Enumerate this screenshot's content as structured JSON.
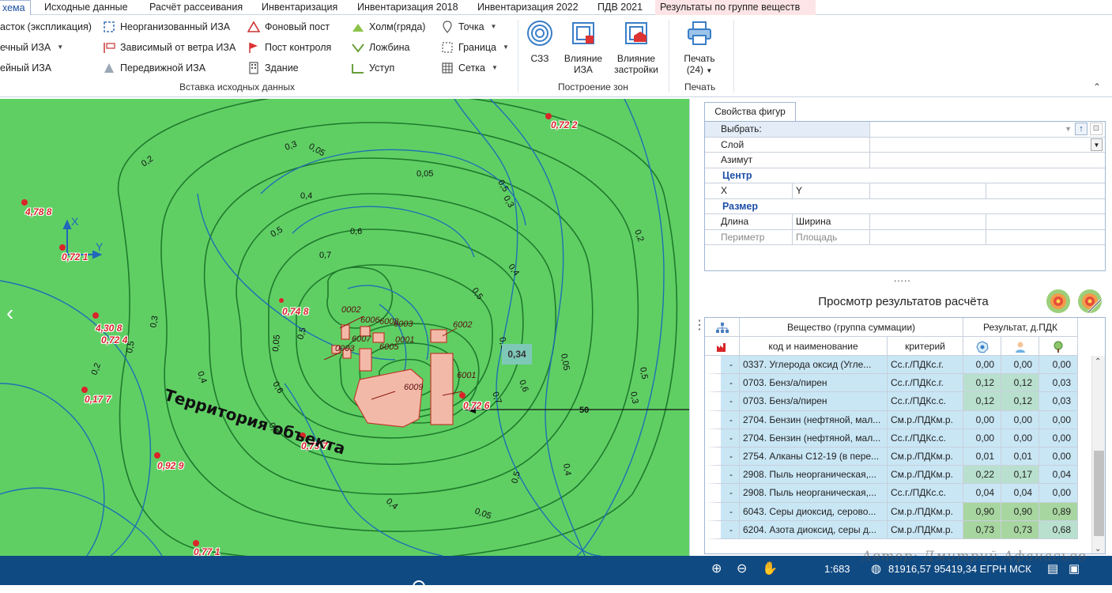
{
  "tabs": [
    "хема",
    "Исходные данные",
    "Расчёт рассеивания",
    "Инвентаризация",
    "Инвентаризация 2018",
    "Инвентаризация 2022",
    "ПДВ 2021",
    "Результаты по группе веществ"
  ],
  "ribbon": {
    "col1": [
      "асток (экспликация)",
      "ечный ИЗА",
      "ейный ИЗА"
    ],
    "col2": [
      "Неорганизованный ИЗА",
      "Зависимый от ветра ИЗА",
      "Передвижной ИЗА"
    ],
    "col3": [
      "Фоновый пост",
      "Пост контроля",
      "Здание"
    ],
    "col4": [
      "Холм(гряда)",
      "Ложбина",
      "Уступ"
    ],
    "col5": [
      "Точка",
      "Граница",
      "Сетка"
    ],
    "group_insert": "Вставка исходных данных",
    "szz": "СЗЗ",
    "iza_influence": [
      "Влияние",
      "ИЗА"
    ],
    "build_influence": [
      "Влияние",
      "застройки"
    ],
    "group_zones": "Построение зон",
    "print": [
      "Печать",
      "(24)"
    ],
    "group_print": "Печать"
  },
  "map": {
    "labels": [
      "0,72 2",
      "4,78 8",
      "0,72 1",
      "4,30 8",
      "0,72 4",
      "0,74 8",
      "0,17 7",
      "0,92 9",
      "0,73 7",
      "0,72 6",
      "0,77 1"
    ],
    "isolines": [
      "0,2",
      "0,3",
      "0,05",
      "0,4",
      "0,05",
      "0,5",
      "0,6",
      "0,7",
      "0,5",
      "0,3",
      "0,2",
      "0,4",
      "0,5",
      "0,6",
      "0,7",
      "0,05",
      "0,05",
      "0,3",
      "0,5",
      "0,4",
      "0,6",
      "0,1",
      "0,6",
      "0,7",
      "0,5",
      "0,4",
      "0,5",
      "0,05",
      "0,05",
      "0,4",
      "0,3",
      "0,2",
      "0,5",
      "0,3",
      "0,05"
    ],
    "sources": [
      "0002",
      "6006",
      "6008",
      "6003",
      "6007",
      "6002",
      "0001",
      "0003",
      "6005",
      "6001",
      "6009"
    ],
    "territory": "Территория объекта",
    "point_value": "0,34",
    "distance": "50",
    "axis_x": "X",
    "axis_y": "Y"
  },
  "properties": {
    "tab": "Свойства фигур",
    "select_label": "Выбрать:",
    "layer": "Слой",
    "azimuth": "Азимут",
    "center": "Центр",
    "x": "X",
    "y": "Y",
    "size": "Размер",
    "length": "Длина",
    "width": "Ширина",
    "perimeter": "Периметр",
    "area": "Площадь",
    "dots": "....."
  },
  "results": {
    "title": "Просмотр результатов расчёта",
    "col_substance": "Вещество (группа суммации)",
    "col_result": "Результат, д.ПДК",
    "col_code": "код и наименование",
    "col_criterion": "критерий",
    "rows": [
      {
        "dash": "-",
        "name": "0337. Углерода оксид (Угле...",
        "crit": "Сс.г./ПДКс.г.",
        "v1": "0,00",
        "v2": "0,00",
        "v3": "0,00"
      },
      {
        "dash": "-",
        "name": "0703. Бенз/а/пирен",
        "crit": "Сс.г./ПДКс.г.",
        "v1": "0,12",
        "v2": "0,12",
        "v3": "0,03"
      },
      {
        "dash": "-",
        "name": "0703. Бенз/а/пирен",
        "crit": "Сс.г./ПДКс.с.",
        "v1": "0,12",
        "v2": "0,12",
        "v3": "0,03"
      },
      {
        "dash": "-",
        "name": "2704. Бензин (нефтяной, мал...",
        "crit": "См.р./ПДКм.р.",
        "v1": "0,00",
        "v2": "0,00",
        "v3": "0,00"
      },
      {
        "dash": "-",
        "name": "2704. Бензин (нефтяной, мал...",
        "crit": "Сс.г./ПДКс.с.",
        "v1": "0,00",
        "v2": "0,00",
        "v3": "0,00"
      },
      {
        "dash": "-",
        "name": "2754. Алканы С12-19 (в пере...",
        "crit": "См.р./ПДКм.р.",
        "v1": "0,01",
        "v2": "0,01",
        "v3": "0,00"
      },
      {
        "dash": "-",
        "name": "2908. Пыль неорганическая,...",
        "crit": "См.р./ПДКм.р.",
        "v1": "0,22",
        "v2": "0,17",
        "v3": "0,04"
      },
      {
        "dash": "-",
        "name": "2908. Пыль неорганическая,...",
        "crit": "Сс.г./ПДКс.с.",
        "v1": "0,04",
        "v2": "0,04",
        "v3": "0,00"
      },
      {
        "dash": "-",
        "name": "6043. Серы диоксид, серово...",
        "crit": "См.р./ПДКм.р.",
        "v1": "0,90",
        "v2": "0,90",
        "v3": "0,89"
      },
      {
        "dash": "-",
        "name": "6204. Азота диоксид, серы д...",
        "crit": "См.р./ПДКм.р.",
        "v1": "0,73",
        "v2": "0,73",
        "v3": "0,68"
      }
    ]
  },
  "status": {
    "scale": "1:683",
    "coords": "81916,57 95419,34 ЕГРН МСК"
  },
  "watermark": "Автор: Дмитрий Афанасьев",
  "colors": {
    "map_bg": "#5fcf64",
    "status_bg": "#104a82",
    "label_red": "#d9252a"
  }
}
